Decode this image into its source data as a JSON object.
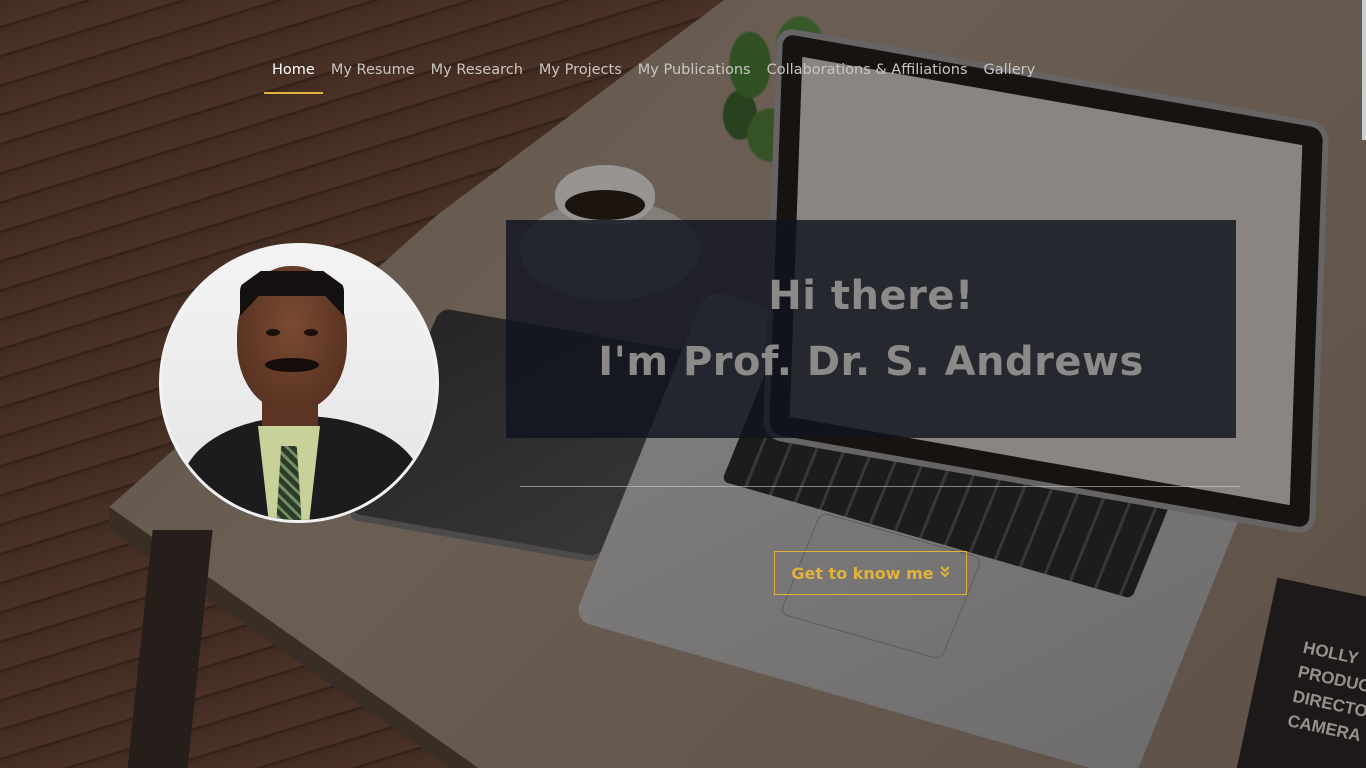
{
  "nav": {
    "items": [
      {
        "label": "Home",
        "active": true
      },
      {
        "label": "My Resume",
        "active": false
      },
      {
        "label": "My Research",
        "active": false
      },
      {
        "label": "My Projects",
        "active": false
      },
      {
        "label": "My Publications",
        "active": false
      },
      {
        "label": "Collaborations & Affiliations",
        "active": false
      },
      {
        "label": "Gallery",
        "active": false
      }
    ]
  },
  "hero": {
    "greeting_line1": "Hi there!",
    "greeting_line2": "I'm Prof. Dr. S. Andrews",
    "cta_label": "Get to know me",
    "cta_icon": "double-chevron-down-icon",
    "accent_color": "#e2b23a"
  },
  "background": {
    "clapperboard_lines": [
      "HOLLY",
      "PRODUC",
      "DIRECTO",
      "CAMERA"
    ]
  }
}
